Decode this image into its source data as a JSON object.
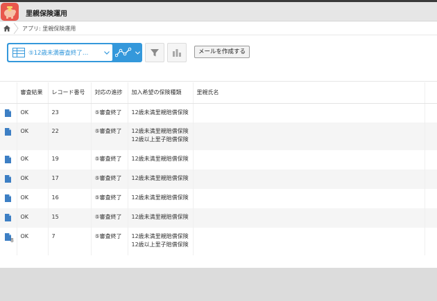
{
  "header": {
    "title": "里親保険運用"
  },
  "breadcrumb": {
    "text": "アプリ: 里親保険運用"
  },
  "toolbar": {
    "view_label": "⑤12歳未満審査終了…",
    "mail_button": "メールを作成する"
  },
  "table": {
    "headers": [
      "審査結果",
      "レコード番号",
      "対応の進捗",
      "加入希望の保険種類",
      "里親氏名"
    ],
    "rows": [
      {
        "result": "OK",
        "record": "23",
        "progress": "⑤審査終了",
        "insurance1": "12歳未満里親賠償保険",
        "insurance2": "",
        "name": ""
      },
      {
        "result": "OK",
        "record": "22",
        "progress": "⑤審査終了",
        "insurance1": "12歳未満里親賠償保険",
        "insurance2": "12歳以上里子賠償保険",
        "name": ""
      },
      {
        "result": "OK",
        "record": "19",
        "progress": "⑤審査終了",
        "insurance1": "12歳未満里親賠償保険",
        "insurance2": "",
        "name": ""
      },
      {
        "result": "OK",
        "record": "17",
        "progress": "⑤審査終了",
        "insurance1": "12歳未満里親賠償保険",
        "insurance2": "",
        "name": ""
      },
      {
        "result": "OK",
        "record": "16",
        "progress": "⑤審査終了",
        "insurance1": "12歳未満里親賠償保険",
        "insurance2": "",
        "name": ""
      },
      {
        "result": "OK",
        "record": "15",
        "progress": "⑤審査終了",
        "insurance1": "12歳未満里親賠償保険",
        "insurance2": "",
        "name": ""
      },
      {
        "result": "OK",
        "record": "7",
        "progress": "⑤審査終了",
        "insurance1": "12歳未満里親賠償保険",
        "insurance2": "12歳以上里子賠償保険",
        "name": "",
        "badge": "8"
      }
    ]
  },
  "icons": {
    "app": "piggy-bank-icon",
    "home": "home-icon",
    "view": "table-icon",
    "graph": "line-graph-icon",
    "filter": "filter-icon",
    "graph_menu": "bar-chart-icon",
    "row": "document-icon"
  },
  "colors": {
    "accent": "#3498db",
    "app_icon": "#e8574c",
    "row_icon": "#3d7fc4"
  }
}
